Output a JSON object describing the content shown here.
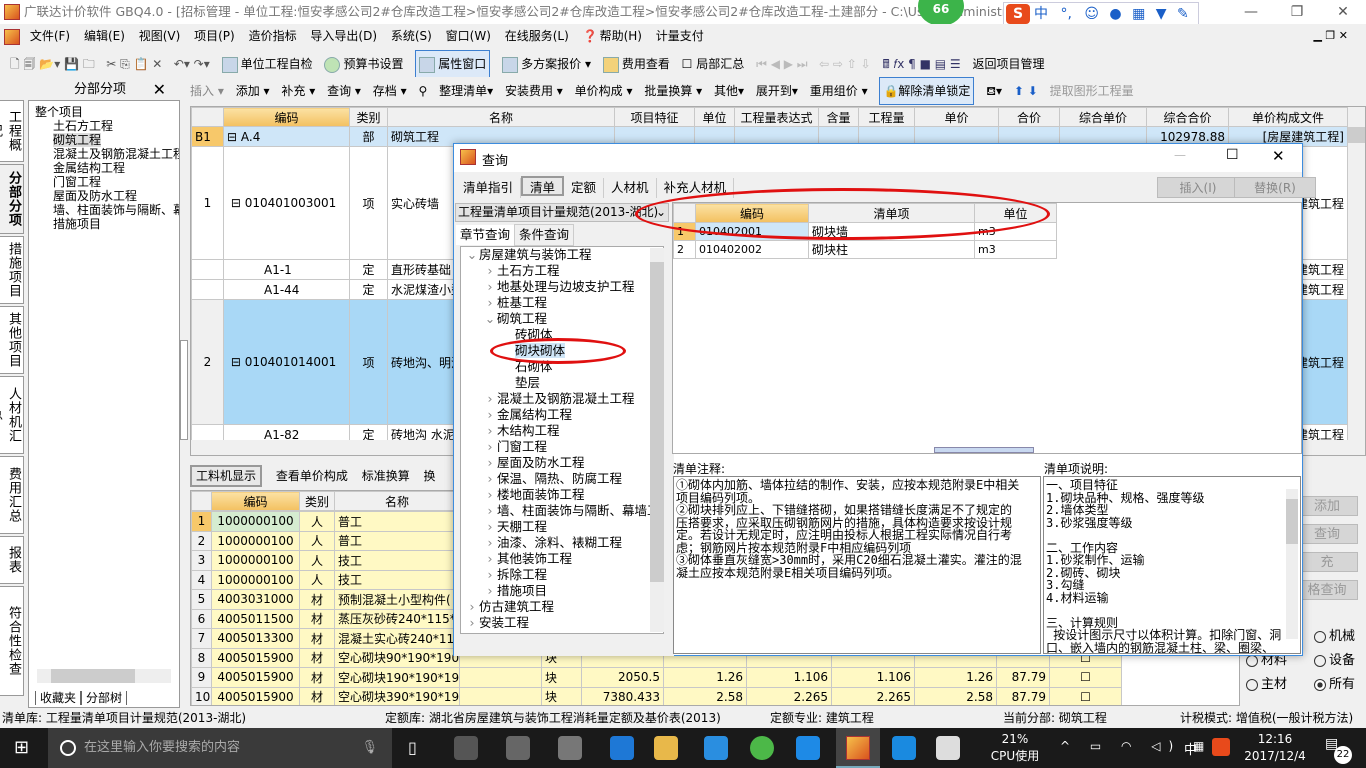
{
  "app": {
    "title": "广联达计价软件 GBQ4.0 - [招标管理 - 单位工程:恒安孝感公司2#仓库改造工程>恒安孝感公司2#仓库改造工程>恒安孝感公司2#仓库改造工程-土建部分 - C:\\Users\\Administrator.PC-...",
    "badge": "66"
  },
  "ime": {
    "labels": [
      "中",
      "°,",
      "☺",
      "🎤",
      "⌨",
      "👕",
      "🔧"
    ]
  },
  "menu": [
    "文件(F)",
    "编辑(E)",
    "视图(V)",
    "项目(P)",
    "造价指标",
    "导入导出(D)",
    "系统(S)",
    "窗口(W)",
    "在线服务(L)",
    "帮助(H)",
    "计量支付"
  ],
  "toolbar1": [
    "单位工程自检",
    "预算书设置",
    "属性窗口",
    "多方案报价",
    "费用查看",
    "局部汇总",
    "返回项目管理"
  ],
  "toolbar2": {
    "panel_title": "分部分项",
    "items": [
      "插入",
      "添加",
      "补充",
      "查询",
      "存档",
      "整理清单",
      "安装费用",
      "单价构成",
      "批量换算",
      "其他",
      "展开到",
      "重用组价",
      "解除清单锁定",
      "提取图形工程量"
    ]
  },
  "side_tabs": [
    "工程概况",
    "分部分项",
    "措施项目",
    "其他项目",
    "人材机汇总",
    "费用汇总",
    "报表",
    "符合性检查"
  ],
  "tree": {
    "root": "整个项目",
    "items": [
      "土石方工程",
      "砌筑工程",
      "混凝土及钢筋混凝土工程",
      "金属结构工程",
      "门窗工程",
      "屋面及防水工程",
      "墙、柱面装饰与隔断、幕墙工程",
      "措施项目"
    ],
    "selected": "砌筑工程",
    "bottom_tabs": [
      "收藏夹",
      "分部树"
    ]
  },
  "main_grid": {
    "columns": [
      "编码",
      "类别",
      "名称",
      "项目特征",
      "单位",
      "工程量表达式",
      "含量",
      "工程量",
      "单价",
      "合价",
      "综合单价",
      "综合合价",
      "单价构成文件"
    ],
    "rows": [
      {
        "no": "B1",
        "code": "A.4",
        "type": "部",
        "name": "砌筑工程",
        "total": "102978.88",
        "file": "[房屋建筑工程]"
      },
      {
        "no": "1",
        "code": "010401003001",
        "type": "项",
        "name": "实心砖墙",
        "file": "建筑工程"
      },
      {
        "no": "",
        "code": "A1-1",
        "type": "定",
        "name": "直形砖基础",
        "file": "建筑工程"
      },
      {
        "no": "",
        "code": "A1-44",
        "type": "定",
        "name": "水泥煤渣小型",
        "file": "建筑工程"
      },
      {
        "no": "2",
        "code": "010401014001",
        "type": "项",
        "name": "砖地沟、明沟",
        "file": "建筑工程"
      },
      {
        "no": "",
        "code": "A1-82",
        "type": "定",
        "name": "砖地沟 水泥",
        "file": "建筑工程"
      }
    ]
  },
  "lower": {
    "tabs": [
      "工料机显示",
      "查看单价构成",
      "标准换算",
      "换"
    ],
    "columns": [
      "编码",
      "类别",
      "名称"
    ],
    "rows": [
      {
        "no": "1",
        "code": "1000000100",
        "type": "人",
        "name": "普工"
      },
      {
        "no": "2",
        "code": "1000000100",
        "type": "人",
        "name": "普工"
      },
      {
        "no": "3",
        "code": "1000000100",
        "type": "人",
        "name": "技工"
      },
      {
        "no": "4",
        "code": "1000000100",
        "type": "人",
        "name": "技工"
      },
      {
        "no": "5",
        "code": "4003031000",
        "type": "材",
        "name": "预制混凝土小型构件("
      },
      {
        "no": "6",
        "code": "4005011500",
        "type": "材",
        "name": "蒸压灰砂砖240*115*53"
      },
      {
        "no": "7",
        "code": "4005013300",
        "type": "材",
        "name": "混凝土实心砖240*115*"
      },
      {
        "no": "8",
        "code": "4005015900",
        "type": "材",
        "name": "空心砌块90*190*190",
        "unit": "块"
      },
      {
        "no": "9",
        "code": "4005015900",
        "type": "材",
        "name": "空心砌块190*190*190",
        "unit": "块",
        "v": [
          "2050.5",
          "1.26",
          "1.106",
          "1.106",
          "1.26",
          "87.79"
        ]
      },
      {
        "no": "10",
        "code": "4005015900",
        "type": "材",
        "name": "空心砌块390*190*190",
        "unit": "块",
        "v": [
          "7380.433",
          "2.58",
          "2.265",
          "2.265",
          "2.58",
          "87.79"
        ]
      }
    ],
    "right_buttons": [
      "添加",
      "查询",
      "充",
      "格查询"
    ],
    "radios": [
      {
        "label": "机械",
        "on": false
      },
      {
        "label": "材料",
        "on": false
      },
      {
        "label": "设备",
        "on": false
      },
      {
        "label": "主材",
        "on": false
      },
      {
        "label": "所有",
        "on": true
      }
    ]
  },
  "dialog": {
    "title": "查询",
    "tabs": [
      "清单指引",
      "清单",
      "定额",
      "人材机",
      "补充人材机"
    ],
    "active_tab": "清单",
    "insert": "插入(I)",
    "replace": "替换(R)",
    "library": "工程量清单项目计量规范(2013-湖北)",
    "subtabs": [
      "章节查询",
      "条件查询"
    ],
    "tree": [
      {
        "label": "房屋建筑与装饰工程",
        "level": 0,
        "open": true
      },
      {
        "label": "土石方工程",
        "level": 1
      },
      {
        "label": "地基处理与边坡支护工程",
        "level": 1
      },
      {
        "label": "桩基工程",
        "level": 1
      },
      {
        "label": "砌筑工程",
        "level": 1,
        "open": true
      },
      {
        "label": "砖砌体",
        "level": 2
      },
      {
        "label": "砌块砌体",
        "level": 2,
        "selected": true
      },
      {
        "label": "石砌体",
        "level": 2
      },
      {
        "label": "垫层",
        "level": 2
      },
      {
        "label": "混凝土及钢筋混凝土工程",
        "level": 1
      },
      {
        "label": "金属结构工程",
        "level": 1
      },
      {
        "label": "木结构工程",
        "level": 1
      },
      {
        "label": "门窗工程",
        "level": 1
      },
      {
        "label": "屋面及防水工程",
        "level": 1
      },
      {
        "label": "保温、隔热、防腐工程",
        "level": 1
      },
      {
        "label": "楼地面装饰工程",
        "level": 1
      },
      {
        "label": "墙、柱面装饰与隔断、幕墙工程",
        "level": 1
      },
      {
        "label": "天棚工程",
        "level": 1
      },
      {
        "label": "油漆、涂料、裱糊工程",
        "level": 1
      },
      {
        "label": "其他装饰工程",
        "level": 1
      },
      {
        "label": "拆除工程",
        "level": 1
      },
      {
        "label": "措施项目",
        "level": 1
      },
      {
        "label": "仿古建筑工程",
        "level": 0
      },
      {
        "label": "安装工程",
        "level": 0
      }
    ],
    "grid_columns": [
      "编码",
      "清单项",
      "单位"
    ],
    "grid_rows": [
      {
        "no": "1",
        "code": "010402001",
        "name": "砌块墙",
        "unit": "m3"
      },
      {
        "no": "2",
        "code": "010402002",
        "name": "砌块柱",
        "unit": "m3"
      }
    ],
    "notes_label": "清单注释:",
    "notes": "①砌体内加筋、墙体拉结的制作、安装，应按本规范附录E中相关\n项目编码列项。\n②砌块排列应上、下错缝搭砌，如果搭错缝长度满足不了规定的\n压搭要求，应采取压砌钢筋网片的措施，具体构造要求按设计规\n定。若设计无规定时，应注明由投标人根据工程实际情况自行考\n虑；钢筋网片按本规范附录F中相应编码列项\n③砌体垂直灰缝宽>30mm时，采用C20细石混凝土灌实。灌注的混\n凝土应按本规范附录E相关项目编码列项。",
    "desc_label": "清单项说明:",
    "desc": "一、项目特征\n1.砌块品种、规格、强度等级\n2.墙体类型\n3.砂浆强度等级\n\n二、工作内容\n1.砂浆制作、运输\n2.砌砖、砌块\n3.勾缝\n4.材料运输\n\n三、计算规则\n 按设计图示尺寸以体积计算。扣除门窗、洞\n口、嵌入墙内的钢筋混凝土柱、梁、圈梁、"
  },
  "status": [
    "清单库: 工程量清单项目计量规范(2013-湖北)",
    "定额库: 湖北省房屋建筑与装饰工程消耗量定额及基价表(2013)",
    "定额专业: 建筑工程",
    "当前分部: 砌筑工程",
    "计税模式: 增值税(一般计税方法)"
  ],
  "taskbar": {
    "search": "在这里输入你要搜索的内容",
    "cpu": "21%",
    "cpu_label": "CPU使用",
    "ime": "中",
    "time": "12:16",
    "date": "2017/12/4",
    "notif": "22"
  },
  "colors": {
    "accent": "#3c8cde",
    "selected_row": "#a9d8f6",
    "header_code": "#f3c060",
    "annotation": "#e01010",
    "material_row": "#fff9c4"
  }
}
